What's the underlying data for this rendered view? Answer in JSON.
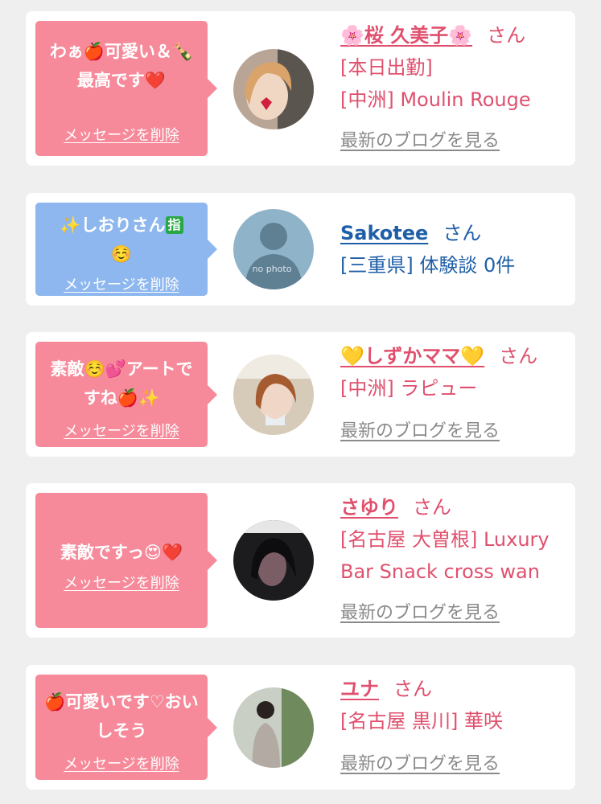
{
  "items": [
    {
      "message": "わぁ🍎可愛い＆🍾最高です❤️",
      "delete_label": "メッセージを削除",
      "name": "🌸桜 久美子🌸",
      "honorific": "さん",
      "meta": [
        "[本日出勤]",
        "[中洲] Moulin Rouge"
      ],
      "blog_link": "最新のブログを見る"
    },
    {
      "message": "✨しおりさん",
      "badge": "指",
      "message_line2": "☺️",
      "delete_label": "メッセージを削除",
      "name": "Sakotee",
      "honorific": "さん",
      "meta": [
        "[三重県] 体験談 0件"
      ],
      "avatar_text": "no photo"
    },
    {
      "message": "素敵☺️💕アートですね🍎✨",
      "delete_label": "メッセージを削除",
      "name": "💛しずかママ💛",
      "honorific": "さん",
      "meta": [
        "[中洲] ラピュー"
      ],
      "blog_link": "最新のブログを見る"
    },
    {
      "message": "素敵ですっ😍❤️",
      "delete_label": "メッセージを削除",
      "name": "さゆり",
      "honorific": "さん",
      "meta": [
        "[名古屋 大曽根] Luxury Bar Snack cross wan"
      ],
      "blog_link": "最新のブログを見る"
    },
    {
      "message": "🍎可愛いです♡おいしそう",
      "delete_label": "メッセージを削除",
      "name": "ユナ",
      "honorific": "さん",
      "meta": [
        "[名古屋 黒川] 華咲"
      ],
      "blog_link": "最新のブログを見る"
    }
  ],
  "colors": {
    "pink_bubble": "#f68a9a",
    "blue_bubble": "#8db7ee",
    "pink_text": "#e0506e",
    "blue_text": "#1f5fa8",
    "link_gray": "#8a8a8a"
  }
}
